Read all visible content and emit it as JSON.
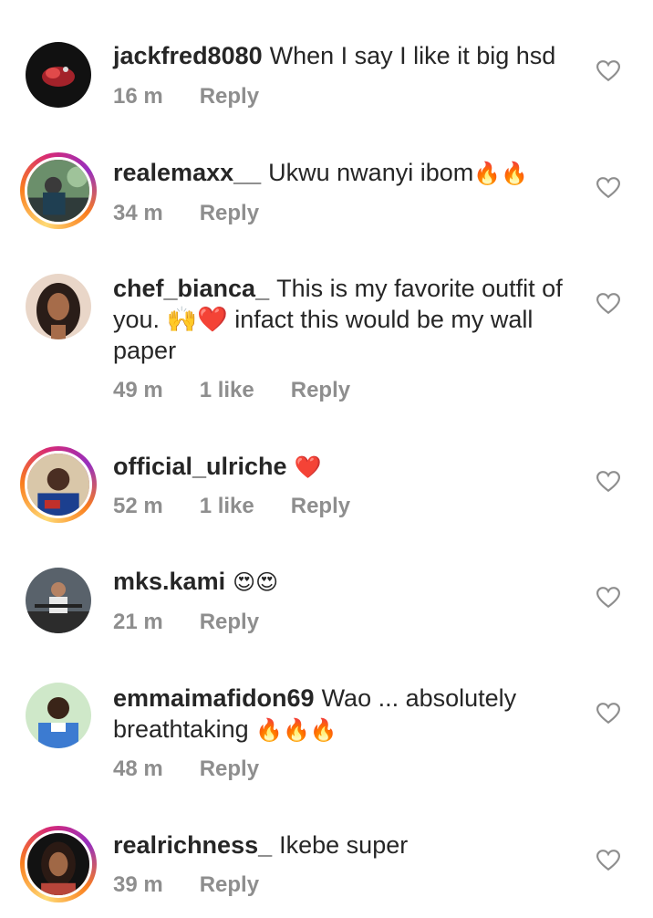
{
  "comments": [
    {
      "username": "jackfred8080",
      "text": "When I say I like it big hsd",
      "emojis": "",
      "time": "16 m",
      "likes": "",
      "reply": "Reply",
      "avatar": "avatar-dark-red"
    },
    {
      "username": "realemaxx__",
      "text": "Ukwu nwanyi ibom",
      "emojis": "🔥🔥",
      "time": "34 m",
      "likes": "",
      "reply": "Reply",
      "avatar": "avatar-outdoor"
    },
    {
      "username": "chef_bianca_",
      "text": "This is my favorite outfit of you. 🙌❤️ infact this would be my wall paper",
      "emojis": "",
      "time": "49 m",
      "likes": "1 like",
      "reply": "Reply",
      "avatar": "avatar-portrait"
    },
    {
      "username": "official_ulriche",
      "text": "",
      "emojis": "❤️",
      "time": "52 m",
      "likes": "1 like",
      "reply": "Reply",
      "avatar": "avatar-selfie"
    },
    {
      "username": "mks.kami",
      "text": "",
      "emojis": "😍😍",
      "time": "21 m",
      "likes": "",
      "reply": "Reply",
      "avatar": "avatar-gym"
    },
    {
      "username": "emmaimafidon69",
      "text": "Wao ... absolutely breathtaking",
      "emojis": "🔥🔥🔥",
      "time": "48 m",
      "likes": "",
      "reply": "Reply",
      "avatar": "avatar-man"
    },
    {
      "username": "realrichness_",
      "text": "Ikebe super",
      "emojis": "",
      "time": "39 m",
      "likes": "",
      "reply": "Reply",
      "avatar": "avatar-woman"
    }
  ],
  "icons": {
    "like": "heart-outline-icon"
  },
  "colors": {
    "text": "#262626",
    "meta": "#8e8e8e",
    "story_ring": "#d62976"
  }
}
